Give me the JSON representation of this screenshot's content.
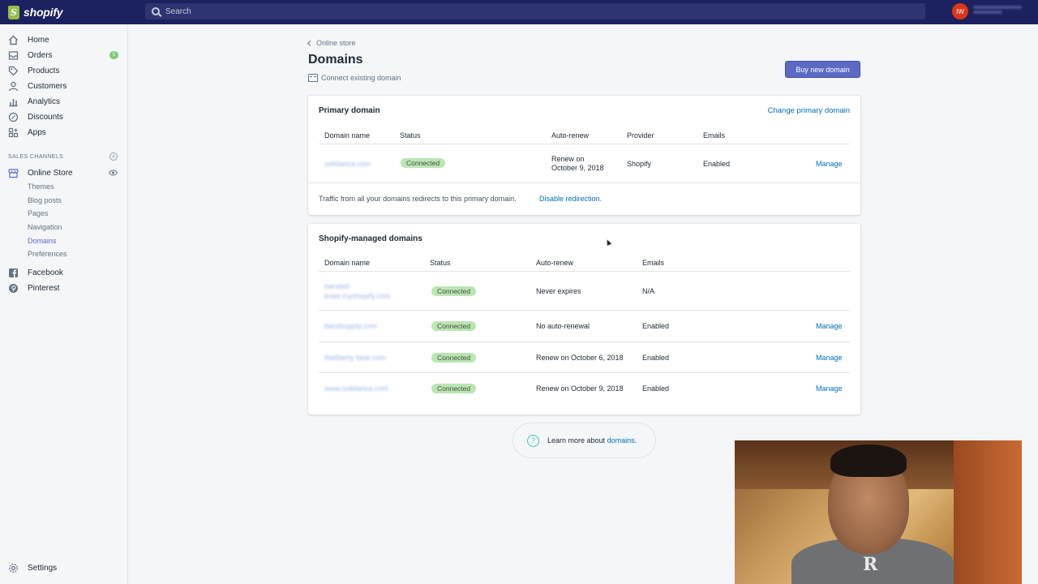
{
  "topbar": {
    "logo_text": "shopify",
    "search_placeholder": "Search",
    "user_initials": "IW"
  },
  "sidebar": {
    "items": [
      {
        "label": "Home",
        "icon": "home-icon"
      },
      {
        "label": "Orders",
        "icon": "orders-icon",
        "badge": "5"
      },
      {
        "label": "Products",
        "icon": "tag-icon"
      },
      {
        "label": "Customers",
        "icon": "person-icon"
      },
      {
        "label": "Analytics",
        "icon": "bar-chart-icon"
      },
      {
        "label": "Discounts",
        "icon": "discount-icon"
      },
      {
        "label": "Apps",
        "icon": "apps-icon"
      }
    ],
    "sales_channels_heading": "SALES CHANNELS",
    "online_store": "Online Store",
    "sub_items": [
      "Themes",
      "Blog posts",
      "Pages",
      "Navigation",
      "Domains",
      "Preferences"
    ],
    "active_sub_item": "Domains",
    "channels": [
      {
        "label": "Facebook",
        "icon": "facebook-icon"
      },
      {
        "label": "Pinterest",
        "icon": "pinterest-icon"
      }
    ],
    "settings": "Settings"
  },
  "page": {
    "breadcrumb": "Online store",
    "title": "Domains",
    "connect_label": "Connect existing domain",
    "buy_button": "Buy new domain"
  },
  "primary": {
    "title": "Primary domain",
    "action": "Change primary domain",
    "headers": [
      "Domain name",
      "Status",
      "Auto-renew",
      "Provider",
      "Emails"
    ],
    "row": {
      "domain": "solidarica.com",
      "status": "Connected",
      "autorenew_line1": "Renew on",
      "autorenew_line2": "October 9, 2018",
      "provider": "Shopify",
      "emails": "Enabled",
      "action": "Manage"
    },
    "footer_text": "Traffic from all your domains redirects to this primary domain.",
    "footer_link": "Disable redirection."
  },
  "managed": {
    "title": "Shopify-managed domains",
    "headers": [
      "Domain name",
      "Status",
      "Auto-renew",
      "Emails"
    ],
    "rows": [
      {
        "domain_line1": "banded-",
        "domain_line2": "knee.myshopify.com",
        "status": "Connected",
        "autorenew": "Never expires",
        "emails": "N/A",
        "action": ""
      },
      {
        "domain": "bandsupply.com",
        "status": "Connected",
        "autorenew": "No auto-renewal",
        "emails": "Enabled",
        "action": "Manage"
      },
      {
        "domain": "theliberty bear.com",
        "status": "Connected",
        "autorenew": "Renew on October 6, 2018",
        "emails": "Enabled",
        "action": "Manage"
      },
      {
        "domain": "www.solidarica.com",
        "status": "Connected",
        "autorenew": "Renew on October 9, 2018",
        "emails": "Enabled",
        "action": "Manage"
      }
    ]
  },
  "help": {
    "prefix": "Learn more about",
    "link": "domains",
    "suffix": "."
  },
  "webcam": {
    "shirt_text": "R"
  },
  "colors": {
    "topbar": "#1c2260",
    "primary_button": "#5c6ac4",
    "link": "#006fbb",
    "connected_pill": "#bbe5b3",
    "help_icon": "#47c1bf"
  }
}
